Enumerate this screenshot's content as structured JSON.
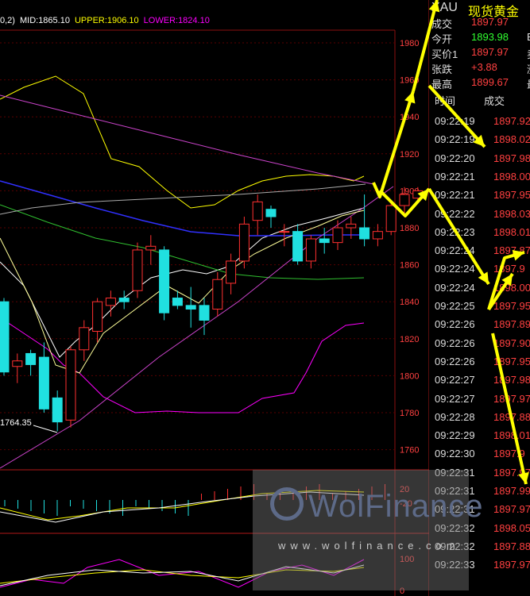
{
  "indicator": {
    "prefix": "0,2)",
    "mid": "MID:1865.10",
    "upper": "UPPER:1906.10",
    "lower": "LOWER:1824.10",
    "colors": {
      "mid": "#ffffff",
      "upper": "#ffff00",
      "lower": "#ff00ff"
    }
  },
  "price_axis": [
    "1980",
    "1960",
    "1940",
    "1920",
    "1900",
    "1880",
    "1860",
    "1840",
    "1820",
    "1800",
    "1780",
    "1760"
  ],
  "macd_axis": [
    "20",
    "-20"
  ],
  "kdj_axis": [
    "100",
    "0"
  ],
  "low_label": "1764.35",
  "quote": {
    "symbol": "XAU",
    "name": "现货黄金",
    "rows": [
      {
        "label": "成交",
        "value": "1897.97",
        "color": "#ff4040",
        "extra": ""
      },
      {
        "label": "今开",
        "value": "1893.98",
        "color": "#30ff30",
        "extra": "B"
      },
      {
        "label": "买价1",
        "value": "1897.97",
        "color": "#ff4040",
        "extra": "卖"
      },
      {
        "label": "张跌",
        "value": "+3.88",
        "color": "#ff4040",
        "extra": "涨"
      },
      {
        "label": "最高",
        "value": "1899.67",
        "color": "#ff4040",
        "extra": "最"
      }
    ]
  },
  "ticks_header": {
    "time": "时间",
    "price": "成交"
  },
  "ticks": [
    {
      "time": "09:22:19",
      "price": "1897.92"
    },
    {
      "time": "09:22:19",
      "price": "1898.02"
    },
    {
      "time": "09:22:20",
      "price": "1897.98"
    },
    {
      "time": "09:22:21",
      "price": "1898.00"
    },
    {
      "time": "09:22:21",
      "price": "1897.95"
    },
    {
      "time": "09:22:22",
      "price": "1898.03"
    },
    {
      "time": "09:22:23",
      "price": "1898.01"
    },
    {
      "time": "09:22:24",
      "price": "1897.87"
    },
    {
      "time": "09:22:24",
      "price": "1897.9"
    },
    {
      "time": "09:22:24",
      "price": "1898.00"
    },
    {
      "time": "09:22:25",
      "price": "1897.95"
    },
    {
      "time": "09:22:26",
      "price": "1897.89"
    },
    {
      "time": "09:22:26",
      "price": "1897.90"
    },
    {
      "time": "09:22:26",
      "price": "1897.95"
    },
    {
      "time": "09:22:27",
      "price": "1897.98"
    },
    {
      "time": "09:22:27",
      "price": "1897.97"
    },
    {
      "time": "09:22:28",
      "price": "1897.88"
    },
    {
      "time": "09:22:29",
      "price": "1898.01"
    },
    {
      "time": "09:22:30",
      "price": "1897.9"
    },
    {
      "time": "09:22:31",
      "price": "1897.97"
    },
    {
      "time": "09:22:31",
      "price": "1897.99"
    },
    {
      "time": "09:22:31",
      "price": "1897.97"
    },
    {
      "time": "09:22:32",
      "price": "1898.05"
    },
    {
      "time": "09:22:32",
      "price": "1897.88"
    },
    {
      "time": "09:22:33",
      "price": "1897.97"
    }
  ],
  "watermark": {
    "logo": "WolFinance",
    "url": "www.wolfinance.com"
  },
  "candles": [
    {
      "o": 1840,
      "h": 1842,
      "l": 1800,
      "c": 1802
    },
    {
      "o": 1805,
      "h": 1812,
      "l": 1796,
      "c": 1808
    },
    {
      "o": 1812,
      "h": 1814,
      "l": 1800,
      "c": 1806
    },
    {
      "o": 1810,
      "h": 1818,
      "l": 1780,
      "c": 1782
    },
    {
      "o": 1788,
      "h": 1792,
      "l": 1770,
      "c": 1775
    },
    {
      "o": 1776,
      "h": 1816,
      "l": 1772,
      "c": 1814
    },
    {
      "o": 1814,
      "h": 1830,
      "l": 1808,
      "c": 1826
    },
    {
      "o": 1824,
      "h": 1842,
      "l": 1818,
      "c": 1840
    },
    {
      "o": 1838,
      "h": 1846,
      "l": 1832,
      "c": 1842
    },
    {
      "o": 1842,
      "h": 1846,
      "l": 1836,
      "c": 1840
    },
    {
      "o": 1846,
      "h": 1872,
      "l": 1842,
      "c": 1868
    },
    {
      "o": 1868,
      "h": 1876,
      "l": 1860,
      "c": 1870
    },
    {
      "o": 1868,
      "h": 1870,
      "l": 1830,
      "c": 1834
    },
    {
      "o": 1842,
      "h": 1846,
      "l": 1836,
      "c": 1838
    },
    {
      "o": 1838,
      "h": 1848,
      "l": 1826,
      "c": 1836
    },
    {
      "o": 1838,
      "h": 1842,
      "l": 1822,
      "c": 1830
    },
    {
      "o": 1836,
      "h": 1856,
      "l": 1832,
      "c": 1852
    },
    {
      "o": 1850,
      "h": 1866,
      "l": 1844,
      "c": 1862
    },
    {
      "o": 1862,
      "h": 1886,
      "l": 1858,
      "c": 1882
    },
    {
      "o": 1884,
      "h": 1898,
      "l": 1876,
      "c": 1894
    },
    {
      "o": 1890,
      "h": 1892,
      "l": 1880,
      "c": 1886
    },
    {
      "o": 1878,
      "h": 1882,
      "l": 1870,
      "c": 1878
    },
    {
      "o": 1878,
      "h": 1882,
      "l": 1860,
      "c": 1862
    },
    {
      "o": 1862,
      "h": 1876,
      "l": 1858,
      "c": 1874
    },
    {
      "o": 1874,
      "h": 1880,
      "l": 1866,
      "c": 1872
    },
    {
      "o": 1872,
      "h": 1884,
      "l": 1868,
      "c": 1880
    },
    {
      "o": 1880,
      "h": 1886,
      "l": 1874,
      "c": 1882
    },
    {
      "o": 1880,
      "h": 1898,
      "l": 1870,
      "c": 1874
    },
    {
      "o": 1874,
      "h": 1882,
      "l": 1870,
      "c": 1878
    },
    {
      "o": 1878,
      "h": 1894,
      "l": 1876,
      "c": 1892
    },
    {
      "o": 1892,
      "h": 1902,
      "l": 1888,
      "c": 1898
    },
    {
      "o": 1896,
      "h": 1902,
      "l": 1894,
      "c": 1900
    }
  ]
}
